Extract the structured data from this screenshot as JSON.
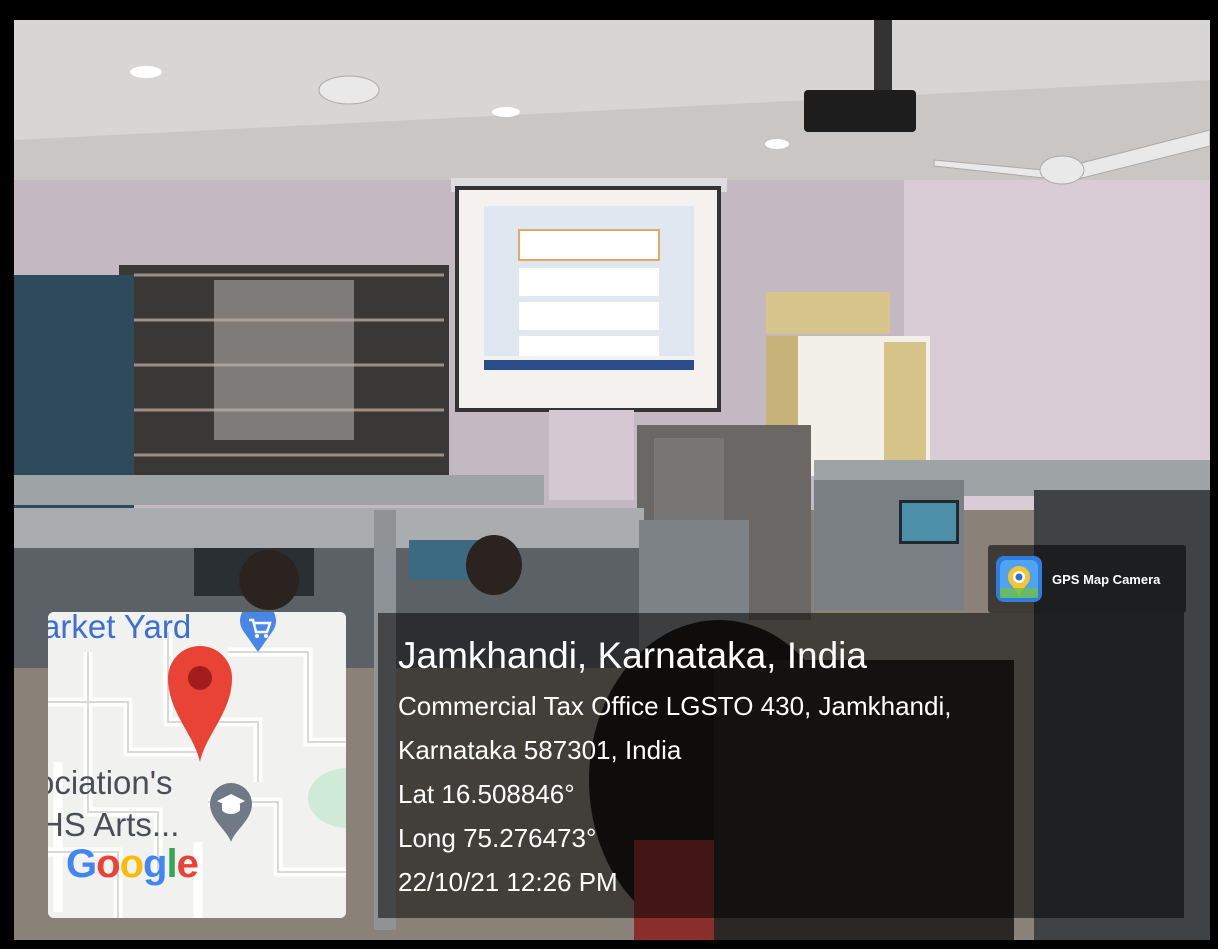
{
  "overlay": {
    "app_badge": {
      "label": "GPS Map Camera",
      "icon": "gps-map-camera-app-icon"
    },
    "location_title": "Jamkhandi, Karnataka, India",
    "address_line1": "Commercial Tax Office LGSTO 430, Jamkhandi,",
    "address_line2": "Karnataka 587301, India",
    "latitude": "Lat 16.508846°",
    "longitude": "Long 75.276473°",
    "datetime": "22/10/21 12:26 PM"
  },
  "map": {
    "label_top": "arket Yard",
    "label_assoc": "ociation's",
    "label_hs": "HS Arts...",
    "logo_letters": [
      "G",
      "o",
      "o",
      "g",
      "l",
      "e"
    ],
    "logo_colors": [
      "#4285F4",
      "#EA4335",
      "#FBBC05",
      "#4285F4",
      "#34A853",
      "#EA4335"
    ],
    "pin_color": "#E84335",
    "icons": [
      "shopping-cart-icon",
      "map-pin-icon",
      "graduation-cap-icon"
    ]
  }
}
